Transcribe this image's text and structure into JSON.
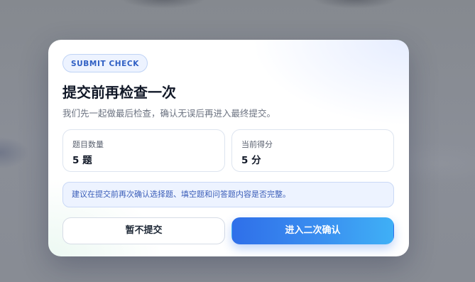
{
  "dialog": {
    "badge": "SUBMIT CHECK",
    "title": "提交前再检查一次",
    "subtitle": "我们先一起做最后检查，确认无误后再进入最终提交。",
    "stats": [
      {
        "label": "题目数量",
        "value": "5 题"
      },
      {
        "label": "当前得分",
        "value": "5 分"
      }
    ],
    "notice": "建议在提交前再次确认选择题、填空题和问答题内容是否完整。",
    "buttons": {
      "cancel_label": "暂不提交",
      "confirm_label": "进入二次确认"
    }
  },
  "colors": {
    "accent": "#2f6fe9",
    "accent_end": "#3fb0f6",
    "badge_text": "#2f5fc4",
    "notice_bg": "#edf3ff",
    "overlay": "#868a93"
  }
}
